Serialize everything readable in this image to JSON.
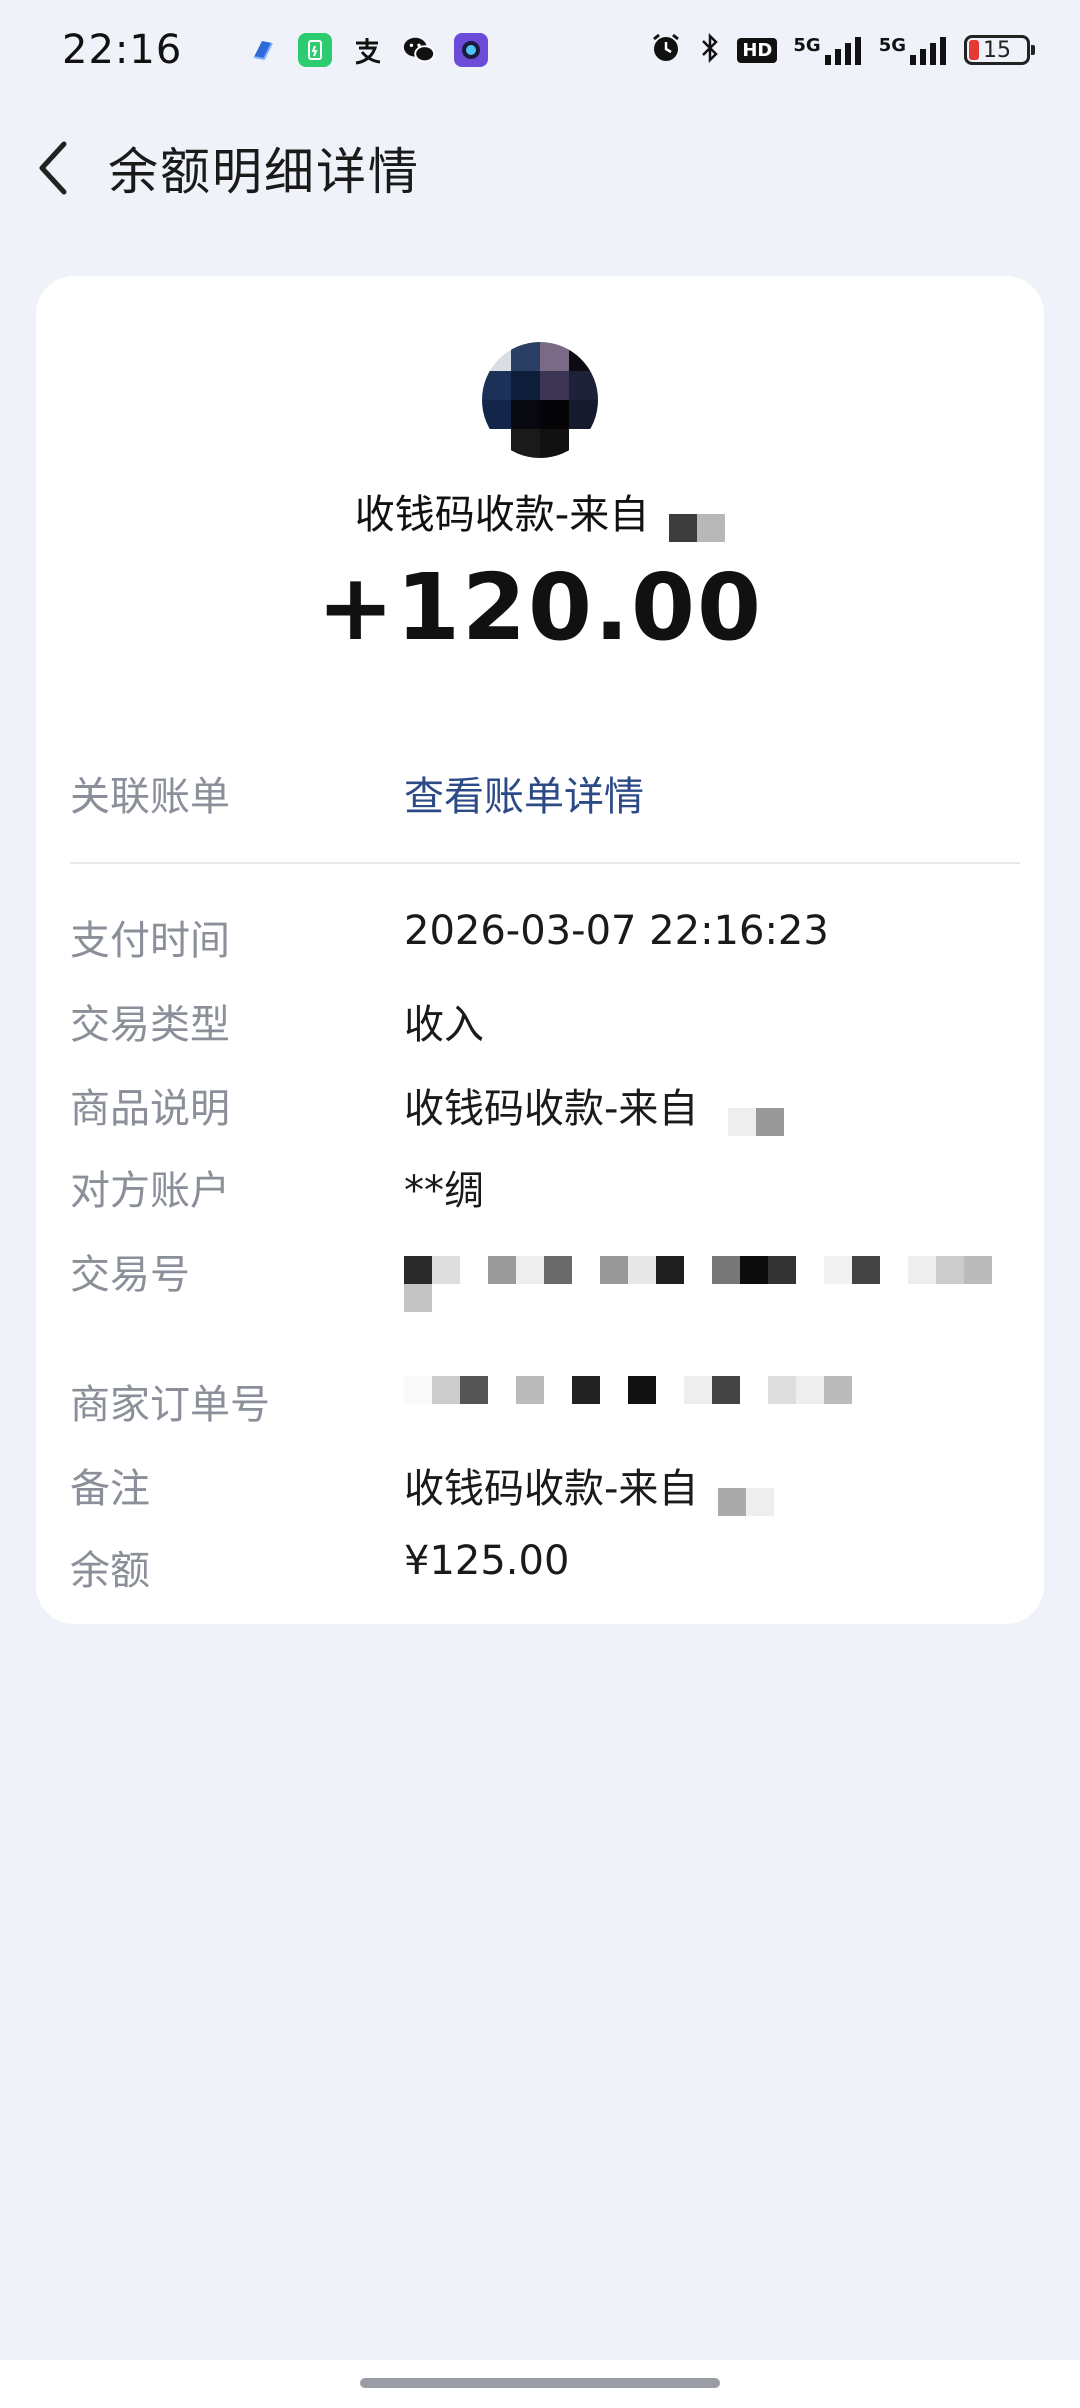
{
  "status_bar": {
    "time": "22:16",
    "apps": [
      "blue-app-icon",
      "battery-app-icon",
      "alipay-icon",
      "wechat-icon",
      "camera-app-icon"
    ],
    "network_hd": "HD",
    "network_1": "5G",
    "network_2": "5G",
    "battery_level": "15"
  },
  "header": {
    "title": "余额明细详情"
  },
  "summary": {
    "subject": "收钱码收款-来自",
    "amount": "+120.00"
  },
  "related_bill": {
    "label": "关联账单",
    "link_text": "查看账单详情"
  },
  "details": {
    "pay_time": {
      "label": "支付时间",
      "value": "2026-03-07 22:16:23"
    },
    "txn_type": {
      "label": "交易类型",
      "value": "收入"
    },
    "product_desc": {
      "label": "商品说明",
      "value": "收钱码收款-来自"
    },
    "counterparty": {
      "label": "对方账户",
      "value": "**绸"
    },
    "txn_no": {
      "label": "交易号"
    },
    "merchant_order": {
      "label": "商家订单号"
    },
    "remark": {
      "label": "备注",
      "value": "收钱码收款-来自"
    },
    "balance": {
      "label": "余额",
      "value": "¥125.00"
    }
  },
  "colors": {
    "background": "#eff2f8",
    "card": "#ffffff",
    "link": "#2b4a86",
    "label": "#8a8f99"
  }
}
